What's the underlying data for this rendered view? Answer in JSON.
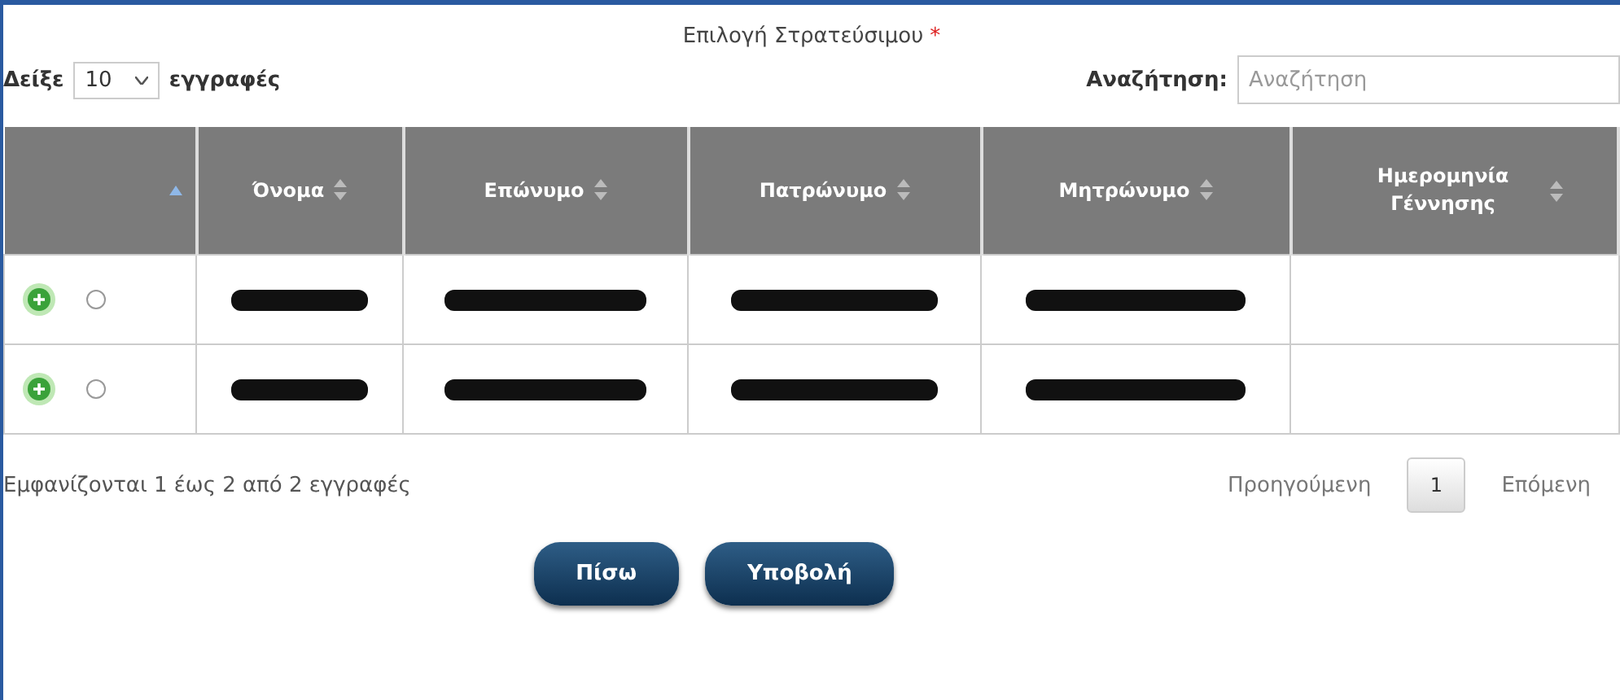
{
  "title": {
    "text": "Επιλογή Στρατεύσιμου",
    "required_mark": "*"
  },
  "length_control": {
    "label_before": "Δείξε",
    "value": "10",
    "label_after": "εγγραφές"
  },
  "search": {
    "label": "Αναζήτηση:",
    "placeholder": "Αναζήτηση"
  },
  "table": {
    "columns": [
      {
        "sorted": true
      },
      {
        "label": "Όνομα",
        "sorted": false
      },
      {
        "label": "Επώνυμο",
        "sorted": false
      },
      {
        "label": "Πατρώνυμο",
        "sorted": false
      },
      {
        "label": "Μητρώνυμο",
        "sorted": false
      },
      {
        "label": "Ημερομηνία Γέννησης",
        "sorted": false
      }
    ],
    "rows": [
      {
        "selected": false,
        "cells": [
          {
            "kind": "redacted"
          },
          {
            "kind": "redacted"
          },
          {
            "kind": "redacted"
          },
          {
            "kind": "redacted"
          },
          {
            "kind": "empty"
          }
        ]
      },
      {
        "selected": false,
        "cells": [
          {
            "kind": "redacted"
          },
          {
            "kind": "redacted"
          },
          {
            "kind": "redacted"
          },
          {
            "kind": "redacted"
          },
          {
            "kind": "empty"
          }
        ]
      }
    ]
  },
  "info": "Εμφανίζονται 1 έως 2 από 2 εγγραφές",
  "pagination": {
    "previous": "Προηγούμενη",
    "pages": [
      {
        "label": "1",
        "selected": true
      }
    ],
    "next": "Επόμενη"
  },
  "buttons": [
    "Πίσω",
    "Υποβολή"
  ]
}
